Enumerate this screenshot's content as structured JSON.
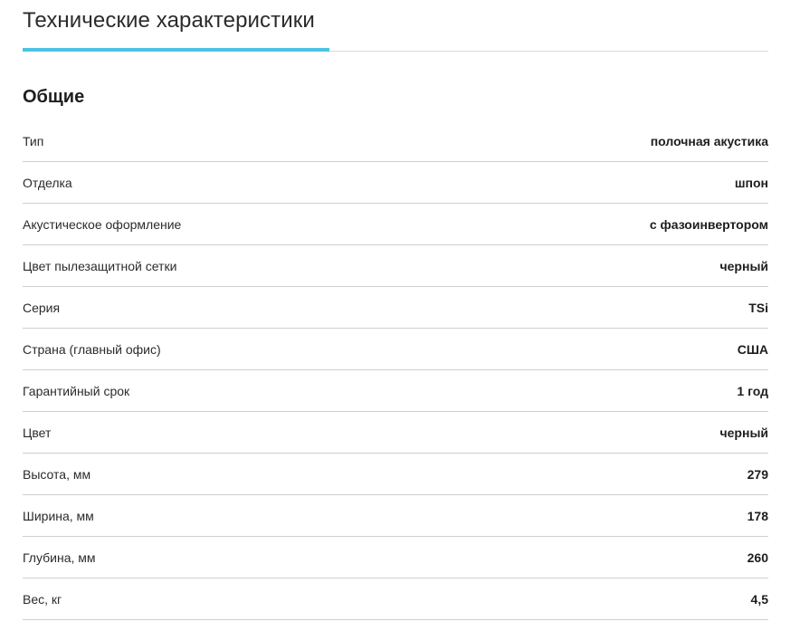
{
  "tabs": [
    {
      "label": "Технические характеристики",
      "active": true
    }
  ],
  "accent_color": "#4cc3e3",
  "section": {
    "title": "Общие"
  },
  "specs": [
    {
      "label": "Тип",
      "value": "полочная акустика"
    },
    {
      "label": "Отделка",
      "value": "шпон"
    },
    {
      "label": "Акустическое оформление",
      "value": "с фазоинвертором"
    },
    {
      "label": "Цвет пылезащитной сетки",
      "value": "черный"
    },
    {
      "label": "Серия",
      "value": "TSi"
    },
    {
      "label": "Страна (главный офис)",
      "value": "США"
    },
    {
      "label": "Гарантийный срок",
      "value": "1 год"
    },
    {
      "label": "Цвет",
      "value": "черный"
    },
    {
      "label": "Высота, мм",
      "value": "279"
    },
    {
      "label": "Ширина, мм",
      "value": "178"
    },
    {
      "label": "Глубина, мм",
      "value": "260"
    },
    {
      "label": "Вес, кг",
      "value": "4,5"
    }
  ]
}
